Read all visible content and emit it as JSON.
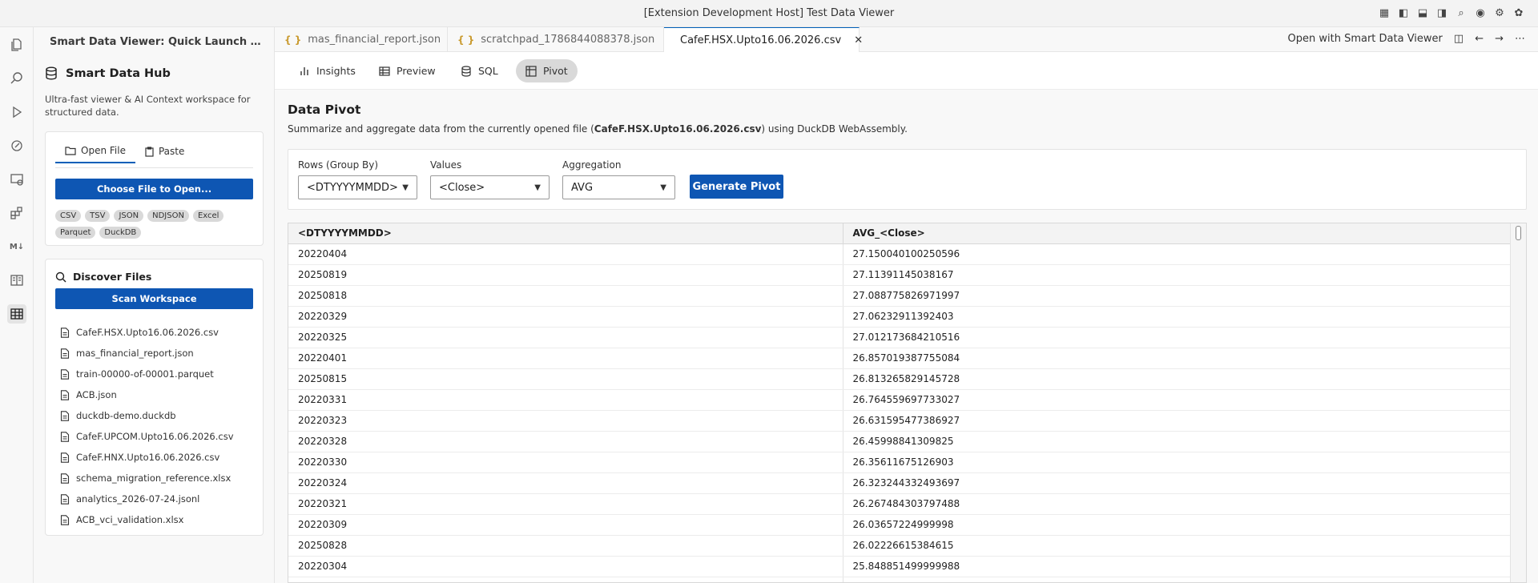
{
  "window": {
    "title": "[Extension Development Host] Test Data Viewer"
  },
  "sidebar": {
    "header": "Smart Data Viewer: Quick Launch & Scratch...",
    "hub_title": "Smart Data Hub",
    "hub_desc": "Ultra-fast viewer & AI Context workspace for structured data.",
    "open_tabs": [
      {
        "label": "Open File"
      },
      {
        "label": "Paste"
      }
    ],
    "choose_file_label": "Choose File to Open...",
    "formats": [
      "CSV",
      "TSV",
      "JSON",
      "NDJSON",
      "Excel",
      "Parquet",
      "DuckDB"
    ],
    "discover_title": "Discover Files",
    "scan_label": "Scan Workspace",
    "files": [
      "CafeF.HSX.Upto16.06.2026.csv",
      "mas_financial_report.json",
      "train-00000-of-00001.parquet",
      "ACB.json",
      "duckdb-demo.duckdb",
      "CafeF.UPCOM.Upto16.06.2026.csv",
      "CafeF.HNX.Upto16.06.2026.csv",
      "schema_migration_reference.xlsx",
      "analytics_2026-07-24.jsonl",
      "ACB_vci_validation.xlsx"
    ]
  },
  "editor_tabs": [
    {
      "label": "mas_financial_report.json"
    },
    {
      "label": "scratchpad_1786844088378.json"
    },
    {
      "label": "CafeF.HSX.Upto16.06.2026.csv"
    }
  ],
  "editor_actions": {
    "open_with": "Open with Smart Data Viewer"
  },
  "viewer_tabs": [
    {
      "label": "Insights"
    },
    {
      "label": "Preview"
    },
    {
      "label": "SQL"
    },
    {
      "label": "Pivot"
    }
  ],
  "pivot": {
    "title": "Data Pivot",
    "desc_prefix": "Summarize and aggregate data from the currently opened file (",
    "desc_file": "CafeF.HSX.Upto16.06.2026.csv",
    "desc_suffix": ") using DuckDB WebAssembly.",
    "rows_label": "Rows (Group By)",
    "rows_value": "<DTYYYYMMDD>",
    "values_label": "Values",
    "values_value": "<Close>",
    "agg_label": "Aggregation",
    "agg_value": "AVG",
    "generate_label": "Generate Pivot"
  },
  "table": {
    "columns": [
      "<DTYYYYMMDD>",
      "AVG_<Close>"
    ],
    "rows": [
      [
        "20220404",
        "27.150040100250596"
      ],
      [
        "20250819",
        "27.11391145038167"
      ],
      [
        "20250818",
        "27.088775826971997"
      ],
      [
        "20220329",
        "27.06232911392403"
      ],
      [
        "20220325",
        "27.012173684210516"
      ],
      [
        "20220401",
        "26.857019387755084"
      ],
      [
        "20250815",
        "26.813265829145728"
      ],
      [
        "20220331",
        "26.764559697733027"
      ],
      [
        "20220323",
        "26.631595477386927"
      ],
      [
        "20220328",
        "26.45998841309825"
      ],
      [
        "20220330",
        "26.35611675126903"
      ],
      [
        "20220324",
        "26.323244332493697"
      ],
      [
        "20220321",
        "26.267484303797488"
      ],
      [
        "20220309",
        "26.03657224999998"
      ],
      [
        "20250828",
        "26.02226615384615"
      ],
      [
        "20220304",
        "25.848851499999988"
      ],
      [
        "",
        ""
      ]
    ]
  }
}
